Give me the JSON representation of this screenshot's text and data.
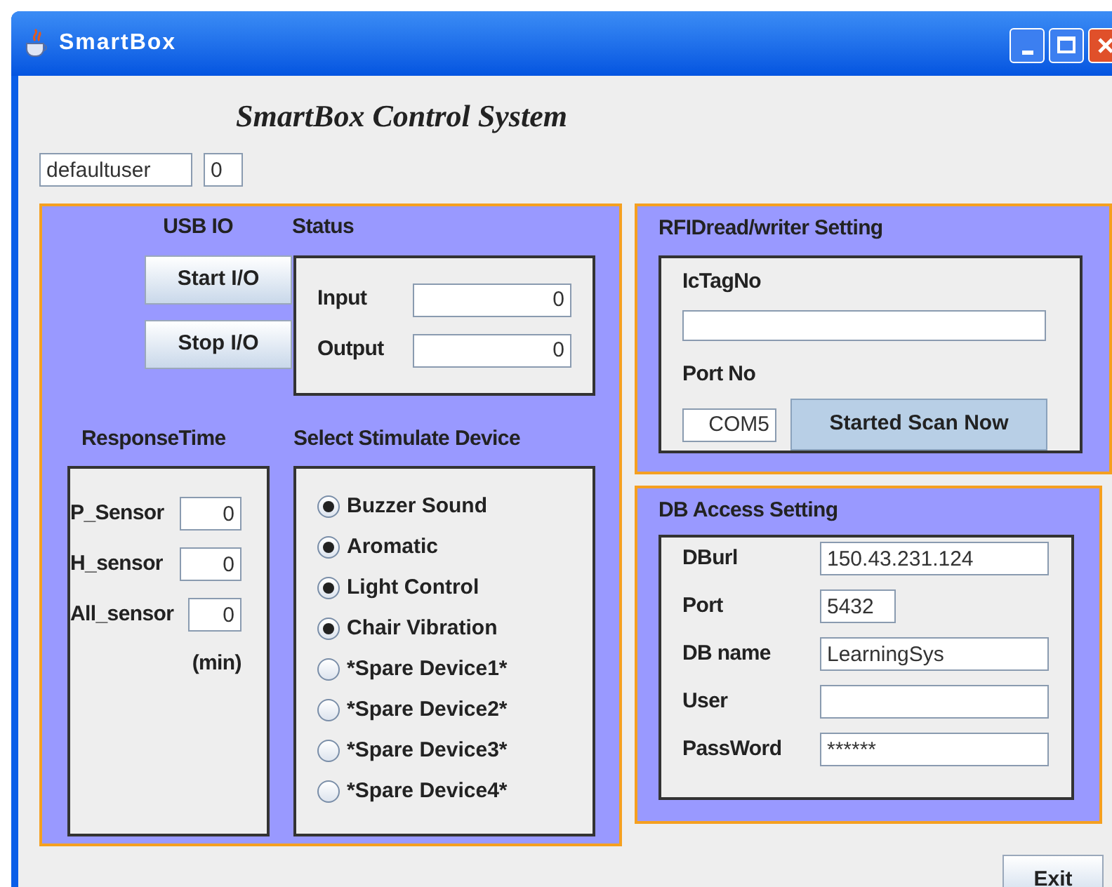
{
  "window": {
    "title": "SmartBox"
  },
  "heading": "SmartBox Control System",
  "user_field": {
    "value": "defaultuser"
  },
  "count_field": {
    "value": "0"
  },
  "usb_io": {
    "title": "USB IO",
    "buttons": [
      "Start I/O",
      "Stop I/O"
    ]
  },
  "status": {
    "title": "Status",
    "fields": [
      {
        "label": "Input",
        "value": "0"
      },
      {
        "label": "Output",
        "value": "0"
      }
    ]
  },
  "response_time": {
    "title": "ResponseTime",
    "fields": [
      {
        "label": "P_Sensor",
        "value": "0"
      },
      {
        "label": "H_sensor",
        "value": "0"
      },
      {
        "label": "All_sensor",
        "value": "0"
      }
    ],
    "unit": "(min)"
  },
  "stimulate_device": {
    "title": "Select Stimulate Device",
    "options": [
      {
        "label": "Buzzer Sound",
        "selected": true
      },
      {
        "label": "Aromatic",
        "selected": true
      },
      {
        "label": "Light Control",
        "selected": true
      },
      {
        "label": "Chair Vibration",
        "selected": true
      },
      {
        "label": "*Spare Device1*",
        "selected": false
      },
      {
        "label": "*Spare Device2*",
        "selected": false
      },
      {
        "label": "*Spare Device3*",
        "selected": false
      },
      {
        "label": "*Spare Device4*",
        "selected": false
      }
    ]
  },
  "rfid": {
    "title": "RFIDread/writer Setting",
    "tag_label": "IcTagNo",
    "port_label": "Port No",
    "port_value": "COM5",
    "scan_button": "Started Scan Now"
  },
  "db": {
    "title": "DB Access Setting",
    "fields": [
      {
        "label": "DBurl",
        "value": "150.43.231.124",
        "kind": "long"
      },
      {
        "label": "Port",
        "value": "5432",
        "kind": "short"
      },
      {
        "label": "DB name",
        "value": "LearningSys",
        "kind": "long"
      },
      {
        "label": "User",
        "kind": "long"
      },
      {
        "label": "PassWord",
        "value": "******",
        "kind": "long"
      }
    ]
  },
  "exit_button": "Exit"
}
